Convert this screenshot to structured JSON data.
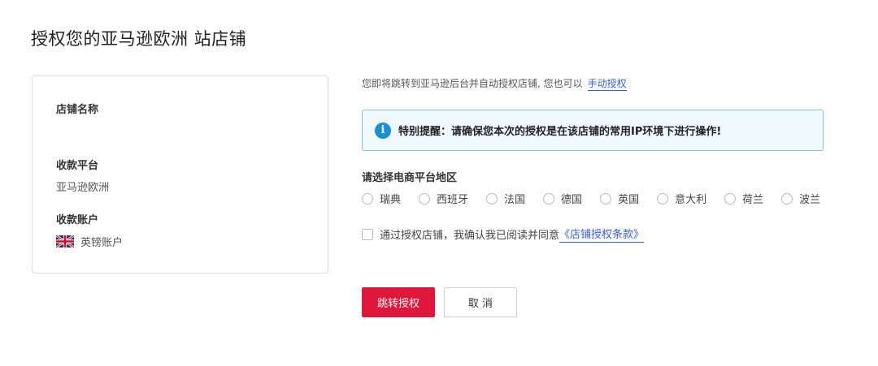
{
  "page": {
    "title": "授权您的亚马逊欧洲 站店铺"
  },
  "store_info": {
    "store_name_label": "店铺名称",
    "store_name_value": "",
    "platform_label": "收款平台",
    "platform_value": "亚马逊欧洲",
    "account_label": "收款账户",
    "account_value": "英镑账户",
    "account_flag": "uk-flag-icon"
  },
  "intro": {
    "text": "您即将跳转到亚马逊后台并自动授权店铺, 您也可以",
    "manual_link": "手动授权"
  },
  "notice": {
    "icon": "info-icon",
    "icon_glyph": "i",
    "text": "特别提醒：请确保您本次的授权是在该店铺的常用IP环境下进行操作!",
    "background": "#eef8fd",
    "border": "#7fc4e6"
  },
  "region": {
    "label": "请选择电商平台地区",
    "options": [
      {
        "label": "瑞典"
      },
      {
        "label": "西班牙"
      },
      {
        "label": "法国"
      },
      {
        "label": "德国"
      },
      {
        "label": "英国"
      },
      {
        "label": "意大利"
      },
      {
        "label": "荷兰"
      },
      {
        "label": "波兰"
      }
    ]
  },
  "agreement": {
    "text": "通过授权店铺，我确认我已阅读并同意",
    "terms_link": "《店铺授权条款》",
    "checked": false
  },
  "actions": {
    "submit_label": "跳转授权",
    "cancel_label": "取 消",
    "primary_color": "#e1163c"
  },
  "colors": {
    "link": "#3a5fcd",
    "accent": "#e1163c",
    "info_blue": "#1a8ed6"
  }
}
